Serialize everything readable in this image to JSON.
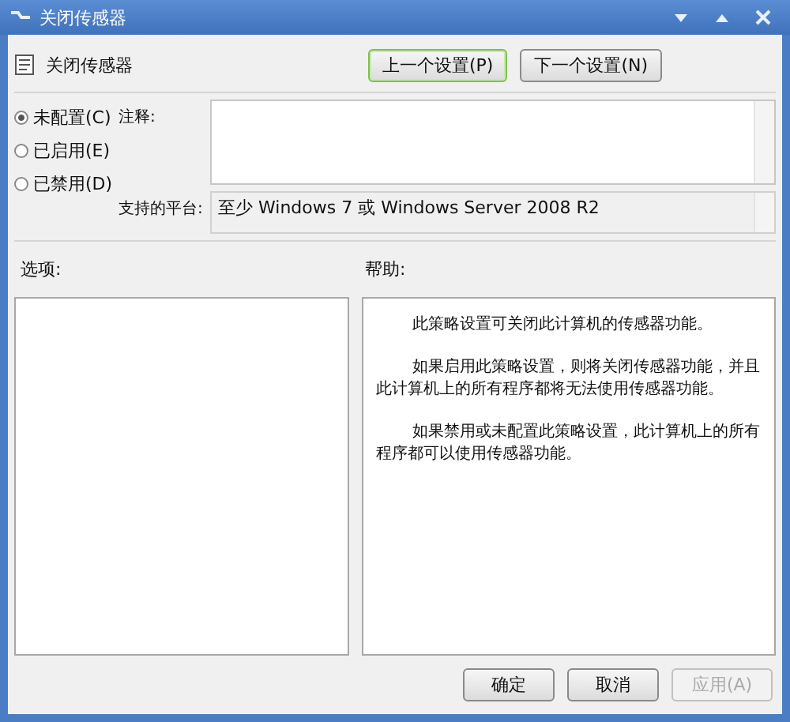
{
  "window": {
    "title": "关闭传感器"
  },
  "header": {
    "title": "关闭传感器"
  },
  "nav_buttons": [
    {
      "label": "上一个设置(P)",
      "selected": true
    },
    {
      "label": "下一个设置(N)",
      "selected": false
    }
  ],
  "options": [
    {
      "label": "未配置(C)",
      "selected": true
    },
    {
      "label": "已启用(E)",
      "selected": false
    },
    {
      "label": "已禁用(D)",
      "selected": false
    }
  ],
  "comment": {
    "label": "注释:"
  },
  "platform": {
    "label": "支持的平台:",
    "value": "至少 Windows 7 或 Windows Server 2008 R2"
  },
  "options_panel": {
    "label": "选项:"
  },
  "help_panel": {
    "label": "帮助:",
    "paragraphs": [
      "此策略设置可关闭此计算机的传感器功能。",
      "如果启用此策略设置，则将关闭传感器功能，并且此计算机上的所有程序都将无法使用传感器功能。",
      "如果禁用或未配置此策略设置，此计算机上的所有程序都可以使用传感器功能。"
    ]
  },
  "buttons": [
    {
      "label": "确定",
      "disabled": false
    },
    {
      "label": "取消",
      "disabled": false
    },
    {
      "label": "应用(A)",
      "disabled": true
    }
  ]
}
